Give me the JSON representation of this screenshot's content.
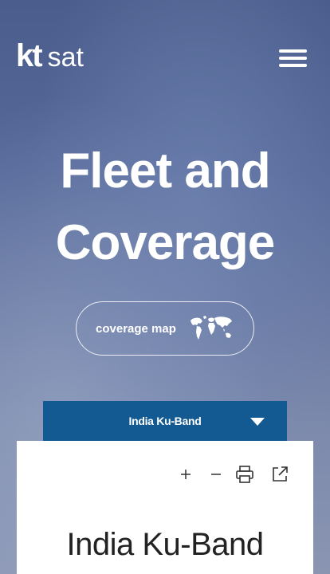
{
  "header": {
    "logo_kt": "kt",
    "logo_sat": "sat",
    "menu_icon": "hamburger-menu-icon"
  },
  "hero": {
    "title_line1": "Fleet and",
    "title_line2": "Coverage"
  },
  "coverage_button": {
    "label": "coverage map",
    "icon": "world-map-icon"
  },
  "dropdown": {
    "selected": "India Ku-Band",
    "icon": "caret-down-icon"
  },
  "panel": {
    "tools": [
      {
        "name": "zoom-in",
        "icon": "plus-icon"
      },
      {
        "name": "zoom-out",
        "icon": "minus-icon"
      },
      {
        "name": "print",
        "icon": "printer-icon"
      },
      {
        "name": "open-external",
        "icon": "external-link-icon"
      }
    ],
    "title": "India Ku-Band"
  },
  "colors": {
    "brand_blue": "#135a92",
    "text_white": "#ffffff",
    "panel_bg": "#ffffff",
    "title_text": "#222222"
  }
}
